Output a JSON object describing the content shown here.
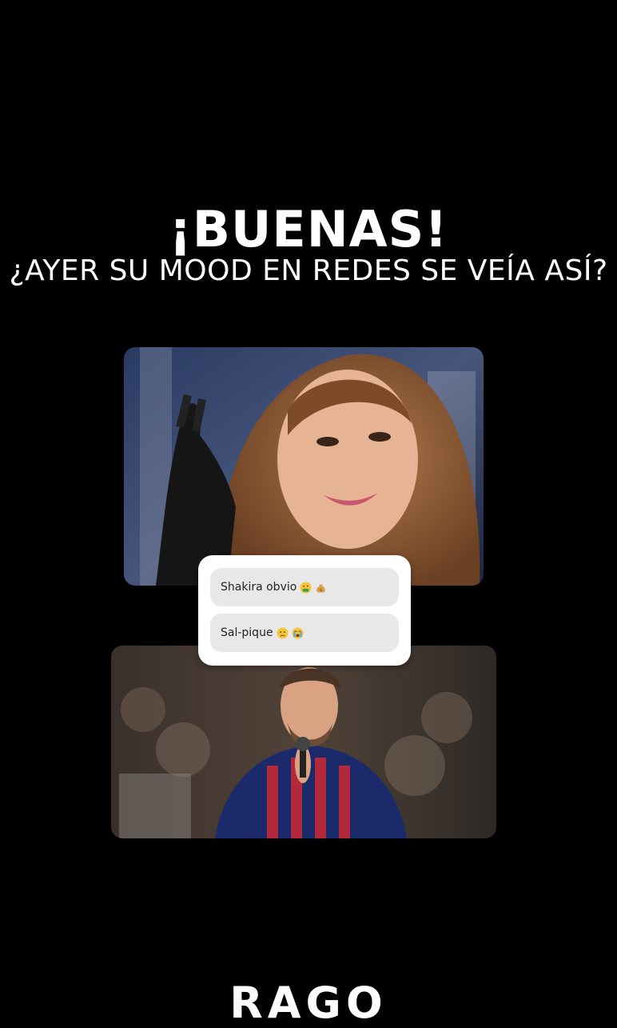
{
  "story": {
    "headline": "¡BUENAS!",
    "subheadline": "¿AYER SU MOOD EN REDES SE VEÍA ASÍ?"
  },
  "photos": {
    "top": {
      "subject": "woman-portrait"
    },
    "bottom": {
      "subject": "crying-footballer"
    }
  },
  "poll": {
    "options": [
      {
        "label": "Shakira obvio",
        "emojis": [
          "money-mouth-face-icon",
          "money-bag-icon"
        ]
      },
      {
        "label": "Sal-pique",
        "emojis": [
          "sad-face-icon",
          "crying-face-icon"
        ]
      }
    ]
  },
  "brand": {
    "logo_text": "RAGO"
  },
  "colors": {
    "background": "#000000",
    "poll_bg": "#ffffff",
    "option_bg": "#e8e8e8"
  }
}
